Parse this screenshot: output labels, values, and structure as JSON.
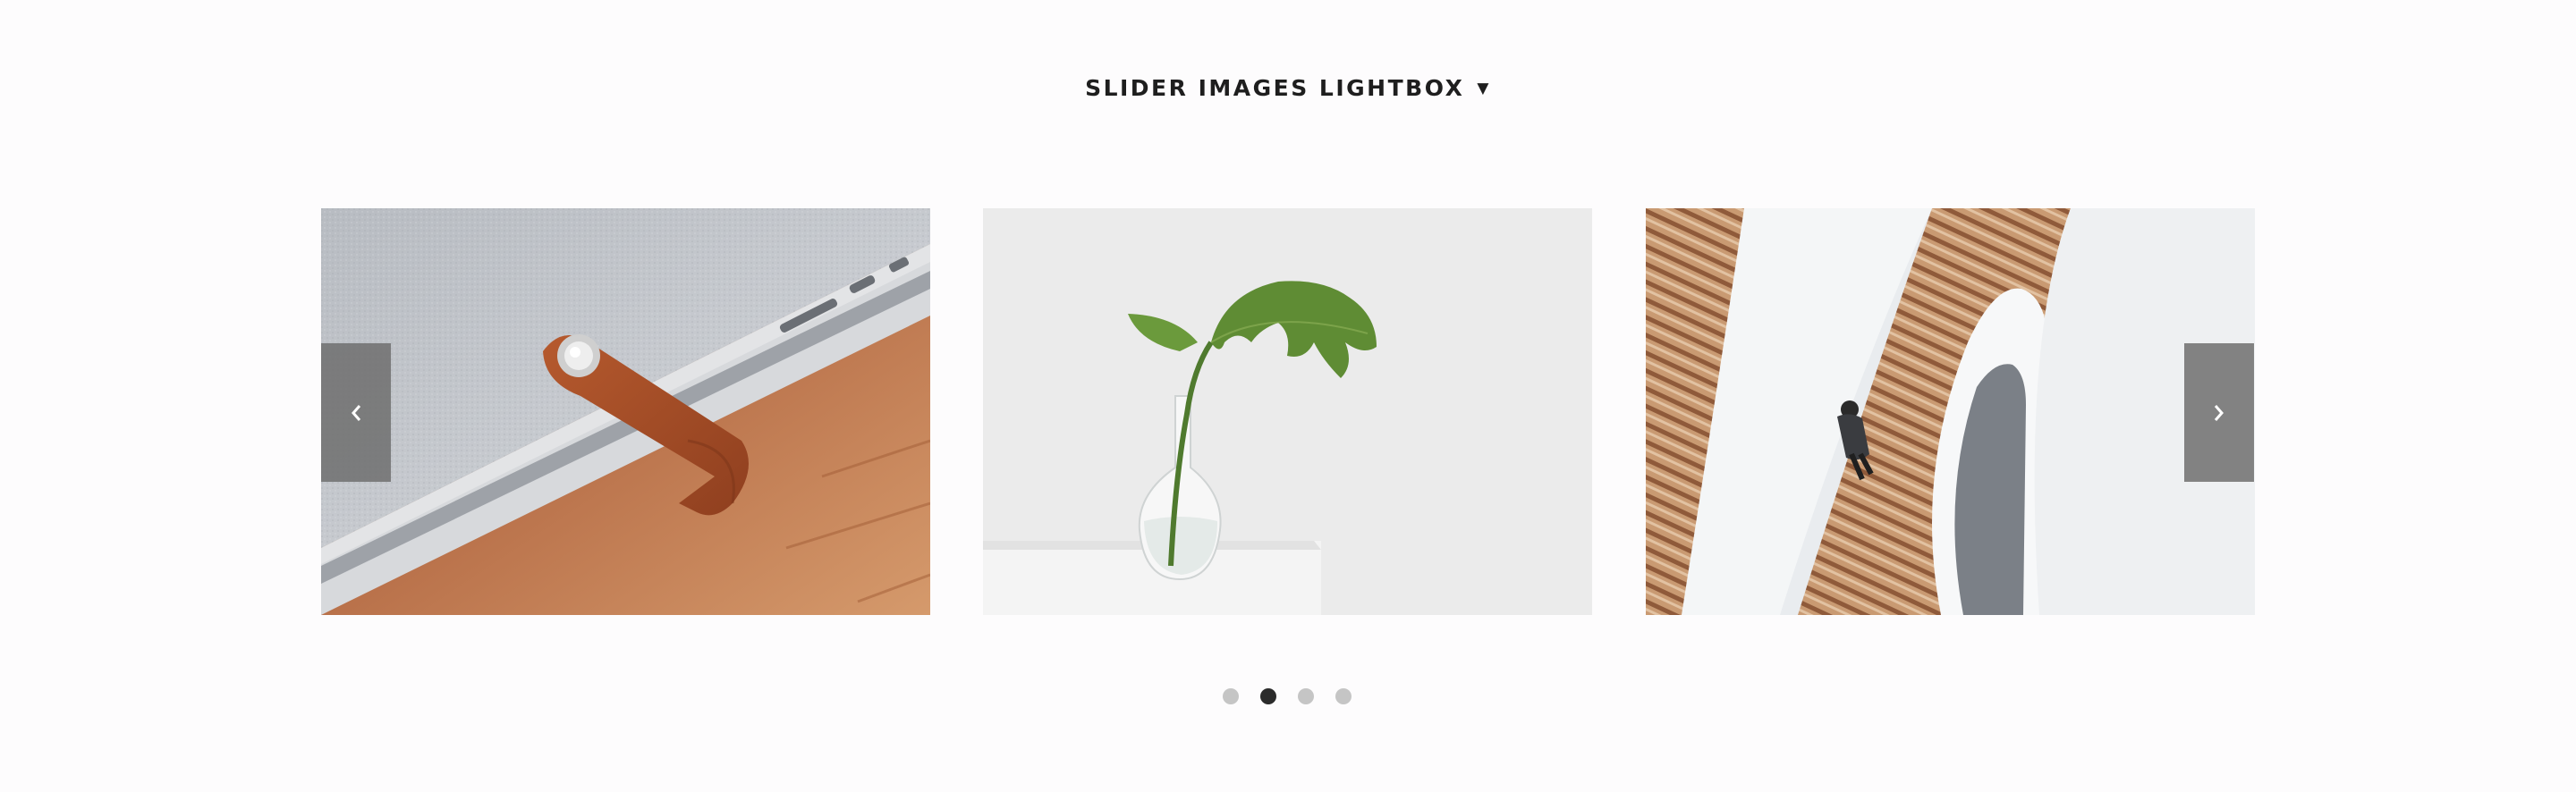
{
  "heading": {
    "label": "SLIDER IMAGES LIGHTBOX",
    "caret_icon": "caret-down-icon",
    "caret_glyph": "▼"
  },
  "slider": {
    "slides": [
      {
        "subject": "felt-laptop-sleeve-with-leather-strap"
      },
      {
        "subject": "monstera-leaf-in-glass-vase"
      },
      {
        "subject": "person-walking-spiral-staircase"
      }
    ],
    "prev_icon": "chevron-left-icon",
    "next_icon": "chevron-right-icon",
    "dots": {
      "count": 4,
      "active_index": 1
    }
  },
  "colors": {
    "background": "#fdfcfd",
    "arrow_bg": "#6e6e6e",
    "dot_inactive": "#c5c5c5",
    "dot_active": "#2b2b2b",
    "heading_text": "#1e1e1e"
  }
}
